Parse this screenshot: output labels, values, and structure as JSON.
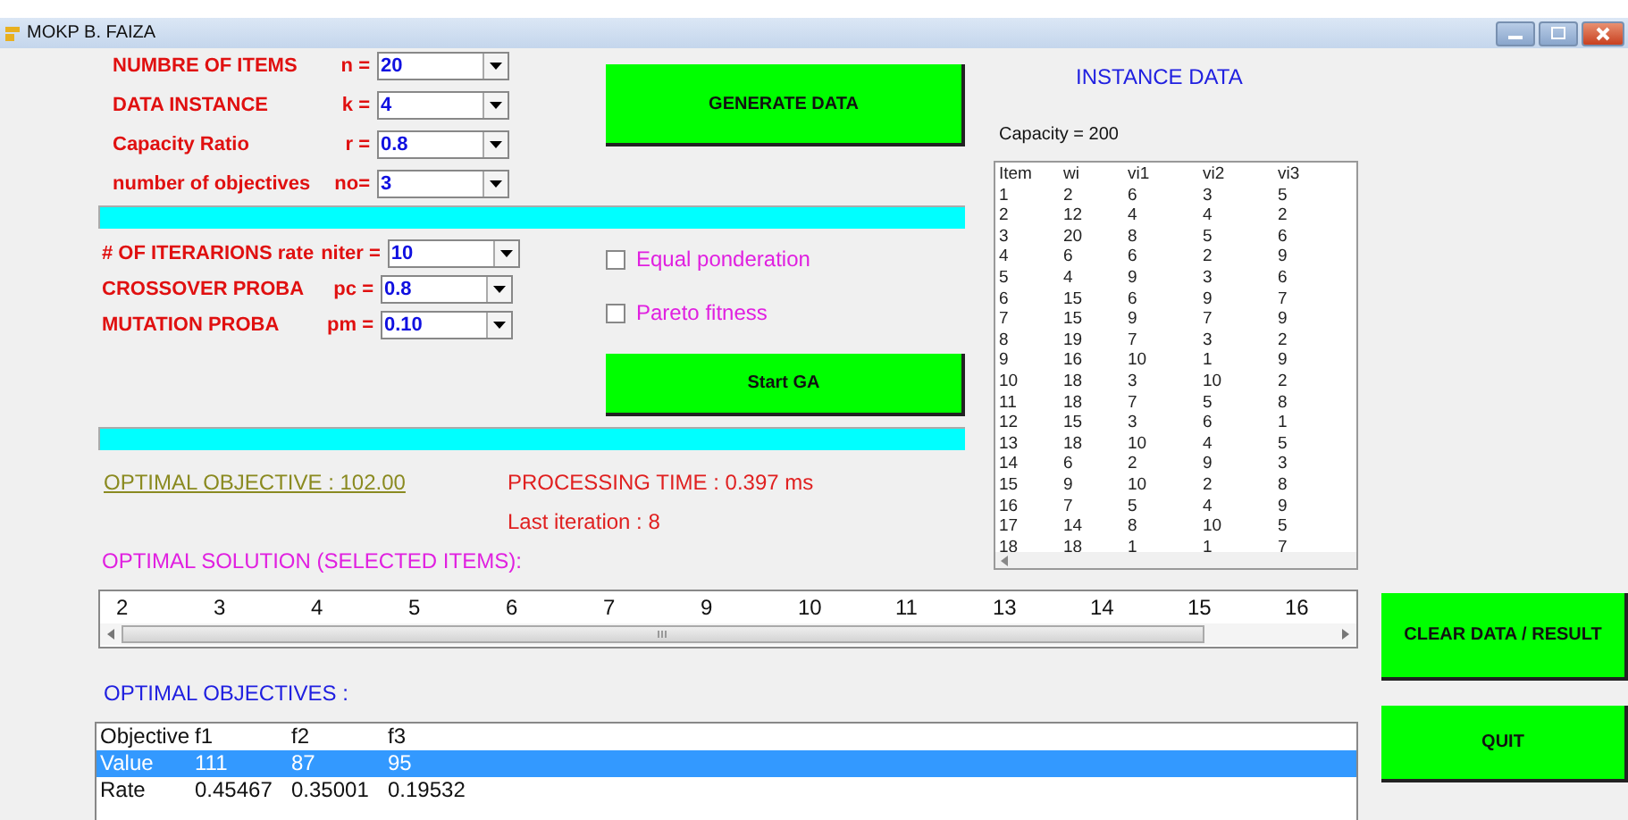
{
  "window": {
    "title": "MOKP B. FAIZA"
  },
  "instance_parameters": [
    {
      "label": "NUMBRE OF ITEMS",
      "symbol": "n =",
      "value": "20"
    },
    {
      "label": "DATA INSTANCE",
      "symbol": "k =",
      "value": "4"
    },
    {
      "label": "Capacity Ratio",
      "symbol": "r =",
      "value": "0.8"
    },
    {
      "label": "number of objectives",
      "symbol": "no=",
      "value": "3"
    }
  ],
  "generate_button": "GENERATE DATA",
  "ga_parameters": [
    {
      "label": "# OF ITERARIONS rate",
      "symbol": "niter =",
      "value": "10"
    },
    {
      "label": "CROSSOVER PROBA",
      "symbol": "pc =",
      "value": "0.8"
    },
    {
      "label": "MUTATION PROBA",
      "symbol": "pm =",
      "value": "0.10"
    }
  ],
  "options": [
    {
      "label": "Equal ponderation",
      "checked": false
    },
    {
      "label": "Pareto fitness",
      "checked": false
    }
  ],
  "start_button": "Start GA",
  "results": {
    "optimal_objective": "OPTIMAL OBJECTIVE : 102.00",
    "processing_time": "PROCESSING TIME : 0.397 ms",
    "last_iteration": "Last iteration : 8",
    "solution_label": "OPTIMAL SOLUTION (SELECTED ITEMS):"
  },
  "instance_data": {
    "title": "INSTANCE DATA",
    "capacity": "Capacity = 200",
    "columns": [
      "Item",
      "wi",
      "vi1",
      "vi2",
      "vi3"
    ],
    "rows": [
      [
        "1",
        "2",
        "6",
        "3",
        "5"
      ],
      [
        "2",
        "12",
        "4",
        "4",
        "2"
      ],
      [
        "3",
        "20",
        "8",
        "5",
        "6"
      ],
      [
        "4",
        "6",
        "6",
        "2",
        "9"
      ],
      [
        "5",
        "4",
        "9",
        "3",
        "6"
      ],
      [
        "6",
        "15",
        "6",
        "9",
        "7"
      ],
      [
        "7",
        "15",
        "9",
        "7",
        "9"
      ],
      [
        "8",
        "19",
        "7",
        "3",
        "2"
      ],
      [
        "9",
        "16",
        "10",
        "1",
        "9"
      ],
      [
        "10",
        "18",
        "3",
        "10",
        "2"
      ],
      [
        "11",
        "18",
        "7",
        "5",
        "8"
      ],
      [
        "12",
        "15",
        "3",
        "6",
        "1"
      ],
      [
        "13",
        "18",
        "10",
        "4",
        "5"
      ],
      [
        "14",
        "6",
        "2",
        "9",
        "3"
      ],
      [
        "15",
        "9",
        "10",
        "2",
        "8"
      ],
      [
        "16",
        "7",
        "5",
        "4",
        "9"
      ],
      [
        "17",
        "14",
        "8",
        "10",
        "5"
      ],
      [
        "18",
        "18",
        "1",
        "1",
        "7"
      ]
    ]
  },
  "selected_items": [
    "2",
    "3",
    "4",
    "5",
    "6",
    "7",
    "9",
    "10",
    "11",
    "13",
    "14",
    "15",
    "16"
  ],
  "objectives": {
    "label": "OPTIMAL OBJECTIVES :",
    "columns": [
      "Objective",
      "f1",
      "f2",
      "f3"
    ],
    "rows": [
      {
        "cells": [
          "Value",
          "111",
          "87",
          "95"
        ],
        "selected": true
      },
      {
        "cells": [
          "Rate",
          "0.45467",
          "0.35001",
          "0.19532"
        ],
        "selected": false
      }
    ]
  },
  "buttons": {
    "clear": "CLEAR DATA / RESULT",
    "quit": "QUIT"
  }
}
